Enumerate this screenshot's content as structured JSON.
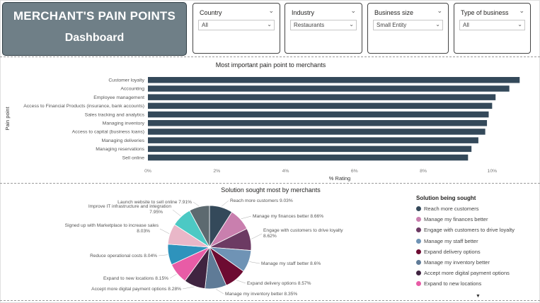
{
  "header": {
    "title_line1": "MERCHANT'S PAIN POINTS",
    "title_line2": "Dashboard"
  },
  "slicers": [
    {
      "label": "Country",
      "value": "All"
    },
    {
      "label": "Industry",
      "value": "Restaurants"
    },
    {
      "label": "Business size",
      "value": "Small Entity"
    },
    {
      "label": "Type of business",
      "value": "All"
    }
  ],
  "icons": {
    "dropdown": "chevron-down-icon",
    "more": "scroll-down-triangle-icon"
  },
  "colors": {
    "title_bg": "#6f7f87",
    "bar": "#34495a"
  },
  "chart_data": [
    {
      "type": "bar",
      "orientation": "horizontal",
      "title": "Most important pain point to merchants",
      "xlabel": "% Rating",
      "ylabel": "Pain point",
      "categories": [
        "Customer loyalty",
        "Accounting",
        "Employee management",
        "Access to Financial Products (insurance, bank accounts)",
        "Sales tracking and analytics",
        "Managing inventory",
        "Access to capital (business loans)",
        "Managing deliveries",
        "Managing reservations",
        "Sell online"
      ],
      "values": [
        10.8,
        10.5,
        10.1,
        10.0,
        9.9,
        9.85,
        9.8,
        9.6,
        9.4,
        9.3
      ],
      "xlim": [
        0,
        11
      ],
      "xticks": [
        0,
        2,
        4,
        6,
        8,
        10
      ],
      "xtick_labels": [
        "0%",
        "2%",
        "4%",
        "6%",
        "8%",
        "10%"
      ],
      "color": "#34495a"
    },
    {
      "type": "pie",
      "title": "Solution sought most by merchants",
      "legend_title": "Solution being sought",
      "slices": [
        {
          "label": "Reach more customers",
          "value": 9.03,
          "pct": "9.03%",
          "color": "#34495a"
        },
        {
          "label": "Manage my finances better",
          "value": 8.66,
          "pct": "8.66%",
          "color": "#c97fae"
        },
        {
          "label": "Engage with customers to drive loyalty",
          "value": 8.62,
          "pct": "8.62%",
          "color": "#6c3a63"
        },
        {
          "label": "Manage my staff better",
          "value": 8.6,
          "pct": "8.6%",
          "color": "#6f93b5"
        },
        {
          "label": "Expand delivery options",
          "value": 8.57,
          "pct": "8.57%",
          "color": "#6d0b32"
        },
        {
          "label": "Manage my inventory better",
          "value": 8.35,
          "pct": "8.35%",
          "color": "#5f7b97"
        },
        {
          "label": "Accept more digital payment options",
          "value": 8.28,
          "pct": "8.28%",
          "color": "#3f2440"
        },
        {
          "label": "Expand to new locations",
          "value": 8.15,
          "pct": "8.15%",
          "color": "#e85ca6"
        },
        {
          "label": "Reduce operational costs",
          "value": 8.04,
          "pct": "8.04%",
          "color": "#2e93bc"
        },
        {
          "label": "Signed up with Marketplace to increase sales",
          "value": 8.03,
          "pct": "8.03%",
          "color": "#e9b7c8"
        },
        {
          "label": "Improve IT infrastructure and integration",
          "value": 7.95,
          "pct": "7.95%",
          "color": "#4cc9c4"
        },
        {
          "label": "Launch website to sell online",
          "value": 7.91,
          "pct": "7.91%",
          "color": "#5d6a70"
        }
      ],
      "legend_visible_count": 8
    }
  ]
}
